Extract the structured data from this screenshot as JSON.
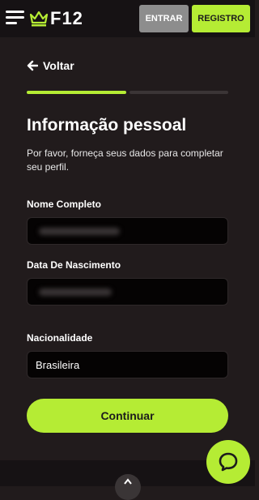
{
  "header": {
    "logo_text": "F12",
    "login_label": "ENTRAR",
    "register_label": "REGISTRO"
  },
  "nav": {
    "back_label": "Voltar"
  },
  "progress": {
    "step": 1,
    "total": 2
  },
  "form": {
    "title": "Informação pessoal",
    "subtitle": "Por favor, forneça seus dados para completar seu perfil.",
    "full_name": {
      "label": "Nome Completo",
      "value": ""
    },
    "birth_date": {
      "label": "Data De Nascimento",
      "value": ""
    },
    "nationality": {
      "label": "Nacionalidade",
      "value": "Brasileira"
    },
    "submit_label": "Continuar"
  },
  "colors": {
    "accent": "#b5ec34",
    "background": "#211b1c",
    "header": "#161214",
    "input_bg": "#050303",
    "login_button": "#8d8d8d"
  },
  "icons": {
    "menu": "hamburger-icon",
    "logo": "crown-icon",
    "back": "arrow-left-icon",
    "chat": "chat-icon",
    "scroll": "chevron-up-icon"
  }
}
